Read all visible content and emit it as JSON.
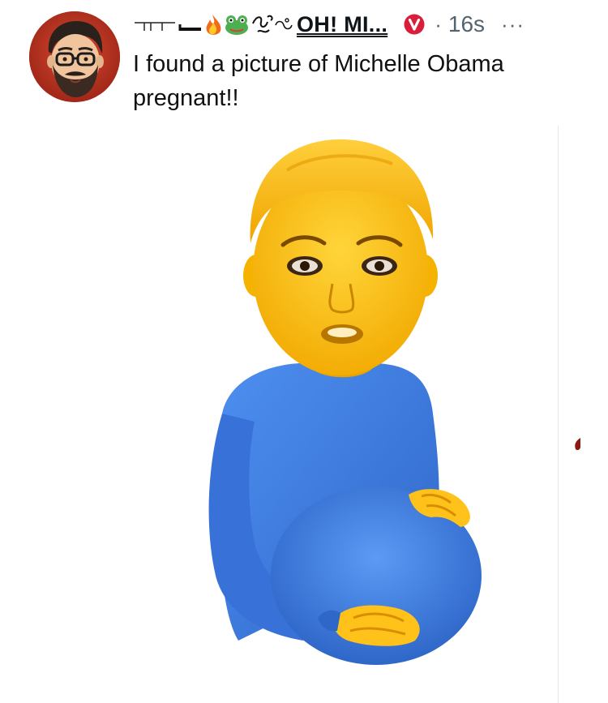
{
  "post": {
    "author": {
      "display_name": "OH! MI...",
      "name_decoration_icons": [
        "divider-line-icon",
        "fire-icon",
        "frog-icon",
        "squiggle-icon"
      ],
      "verified_icon": "red-v-badge-icon",
      "avatar_icon": "bearded-man-glasses-avatar"
    },
    "separator": "·",
    "timestamp": "16s",
    "more_label": "···",
    "text": "I found a picture of Michelle Obama pregnant!!",
    "media": {
      "icon": "pregnant-person-emoji-image"
    }
  },
  "colors": {
    "accent_red": "#d81e3a",
    "meta_gray": "#536471",
    "emoji_yellow": "#ffcc1a",
    "shirt_blue": "#3d7de0"
  }
}
